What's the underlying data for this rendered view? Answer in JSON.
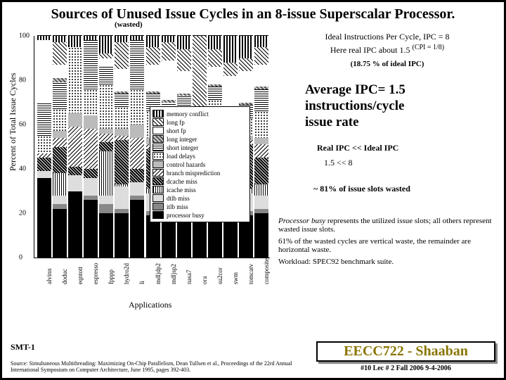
{
  "title": "Sources of Unused Issue Cycles in an 8-issue Superscalar Processor.",
  "wasted_label": "(wasted)",
  "notes": {
    "l1": "Ideal Instructions Per Cycle, IPC = 8",
    "l2": "Here real IPC about 1.5",
    "l2_sup": "(CPI = 1/8)",
    "l3": "(18.75 % of ideal IPC)"
  },
  "big": {
    "a": "Average IPC= 1.5",
    "b": "instructions/cycle",
    "c": "issue rate"
  },
  "cmp": "Real IPC  <<   Ideal IPC",
  "cmp2": "1.5        <<    8",
  "wnote": "~ 81% of issue slots wasted",
  "foot": {
    "p1a": "Processor busy",
    "p1b": " represents the utilized issue slots; all others represent wasted issue slots.",
    "p2": "61% of the wasted cycles are vertical waste, the remainder are horizontal waste.",
    "p3": "Workload: SPEC92 benchmark suite."
  },
  "smt": "SMT-1",
  "src": "Source: Simultaneous Multithreading: Maximizing On-Chip Parallelism,  Dean Tullsen et al., Proceedings of the 22rd Annual International Symposium on Computer Architecture, June 1995, pages 392-403.",
  "badge": {
    "top": "EECC722 - Shaaban",
    "bot": "#10   Lec # 2  Fall 2006  9-4-2006"
  },
  "ylabel": "Percent of Total Issue Cycles",
  "xlabel": "Applications",
  "chart_data": {
    "type": "stacked-bar",
    "ylim": [
      0,
      100
    ],
    "yticks": [
      0,
      20,
      40,
      60,
      80,
      100
    ],
    "categories": [
      "alvinn",
      "doduc",
      "eqntott",
      "espresso",
      "fpppp",
      "hydro2d",
      "li",
      "mdljdp2",
      "mdljsp2",
      "nasa7",
      "ora",
      "su2cor",
      "swm",
      "tomcatv",
      "composite"
    ],
    "legend": [
      "memory conflict",
      "long fp",
      "short fp",
      "long integer",
      "short integer",
      "load delays",
      "control hazards",
      "branch misprediction",
      "dcache miss",
      "icache miss",
      "dtlb miss",
      "itlb miss",
      "processor busy"
    ],
    "series": [
      {
        "name": "memory conflict",
        "values": [
          2,
          3,
          5,
          2,
          8,
          3,
          2,
          5,
          3,
          6,
          0,
          6,
          12,
          10,
          5
        ]
      },
      {
        "name": "long fp",
        "values": [
          0,
          10,
          0,
          0,
          2,
          12,
          0,
          8,
          8,
          10,
          36,
          8,
          6,
          6,
          8
        ]
      },
      {
        "name": "short fp",
        "values": [
          28,
          6,
          0,
          0,
          4,
          10,
          0,
          12,
          18,
          10,
          20,
          8,
          22,
          14,
          10
        ]
      },
      {
        "name": "long integer",
        "values": [
          0,
          2,
          0,
          0,
          0,
          1,
          0,
          1,
          1,
          1,
          0,
          1,
          0,
          1,
          1
        ]
      },
      {
        "name": "short integer",
        "values": [
          15,
          12,
          0,
          22,
          8,
          6,
          22,
          8,
          20,
          10,
          0,
          6,
          10,
          6,
          10
        ]
      },
      {
        "name": "load delays",
        "values": [
          8,
          10,
          30,
          12,
          20,
          10,
          16,
          12,
          12,
          8,
          2,
          8,
          6,
          8,
          12
        ]
      },
      {
        "name": "control hazards",
        "values": [
          0,
          3,
          6,
          6,
          2,
          3,
          6,
          3,
          2,
          2,
          0,
          2,
          0,
          2,
          3
        ]
      },
      {
        "name": "branch misprediction",
        "values": [
          2,
          4,
          18,
          18,
          4,
          2,
          14,
          2,
          2,
          2,
          0,
          2,
          0,
          2,
          6
        ]
      },
      {
        "name": "dcache miss",
        "values": [
          6,
          12,
          4,
          4,
          4,
          20,
          6,
          18,
          8,
          18,
          4,
          26,
          6,
          20,
          12
        ]
      },
      {
        "name": "icache miss",
        "values": [
          0,
          10,
          0,
          0,
          20,
          1,
          0,
          2,
          0,
          2,
          0,
          2,
          0,
          2,
          5
        ]
      },
      {
        "name": "dtlb miss",
        "values": [
          3,
          4,
          7,
          8,
          4,
          10,
          6,
          8,
          4,
          8,
          2,
          10,
          8,
          8,
          6
        ]
      },
      {
        "name": "itlb miss",
        "values": [
          0,
          2,
          0,
          2,
          4,
          2,
          2,
          2,
          2,
          2,
          0,
          2,
          0,
          2,
          2
        ]
      },
      {
        "name": "processor busy",
        "values": [
          36,
          22,
          30,
          26,
          20,
          20,
          26,
          19,
          20,
          21,
          36,
          19,
          30,
          19,
          20
        ]
      }
    ]
  }
}
